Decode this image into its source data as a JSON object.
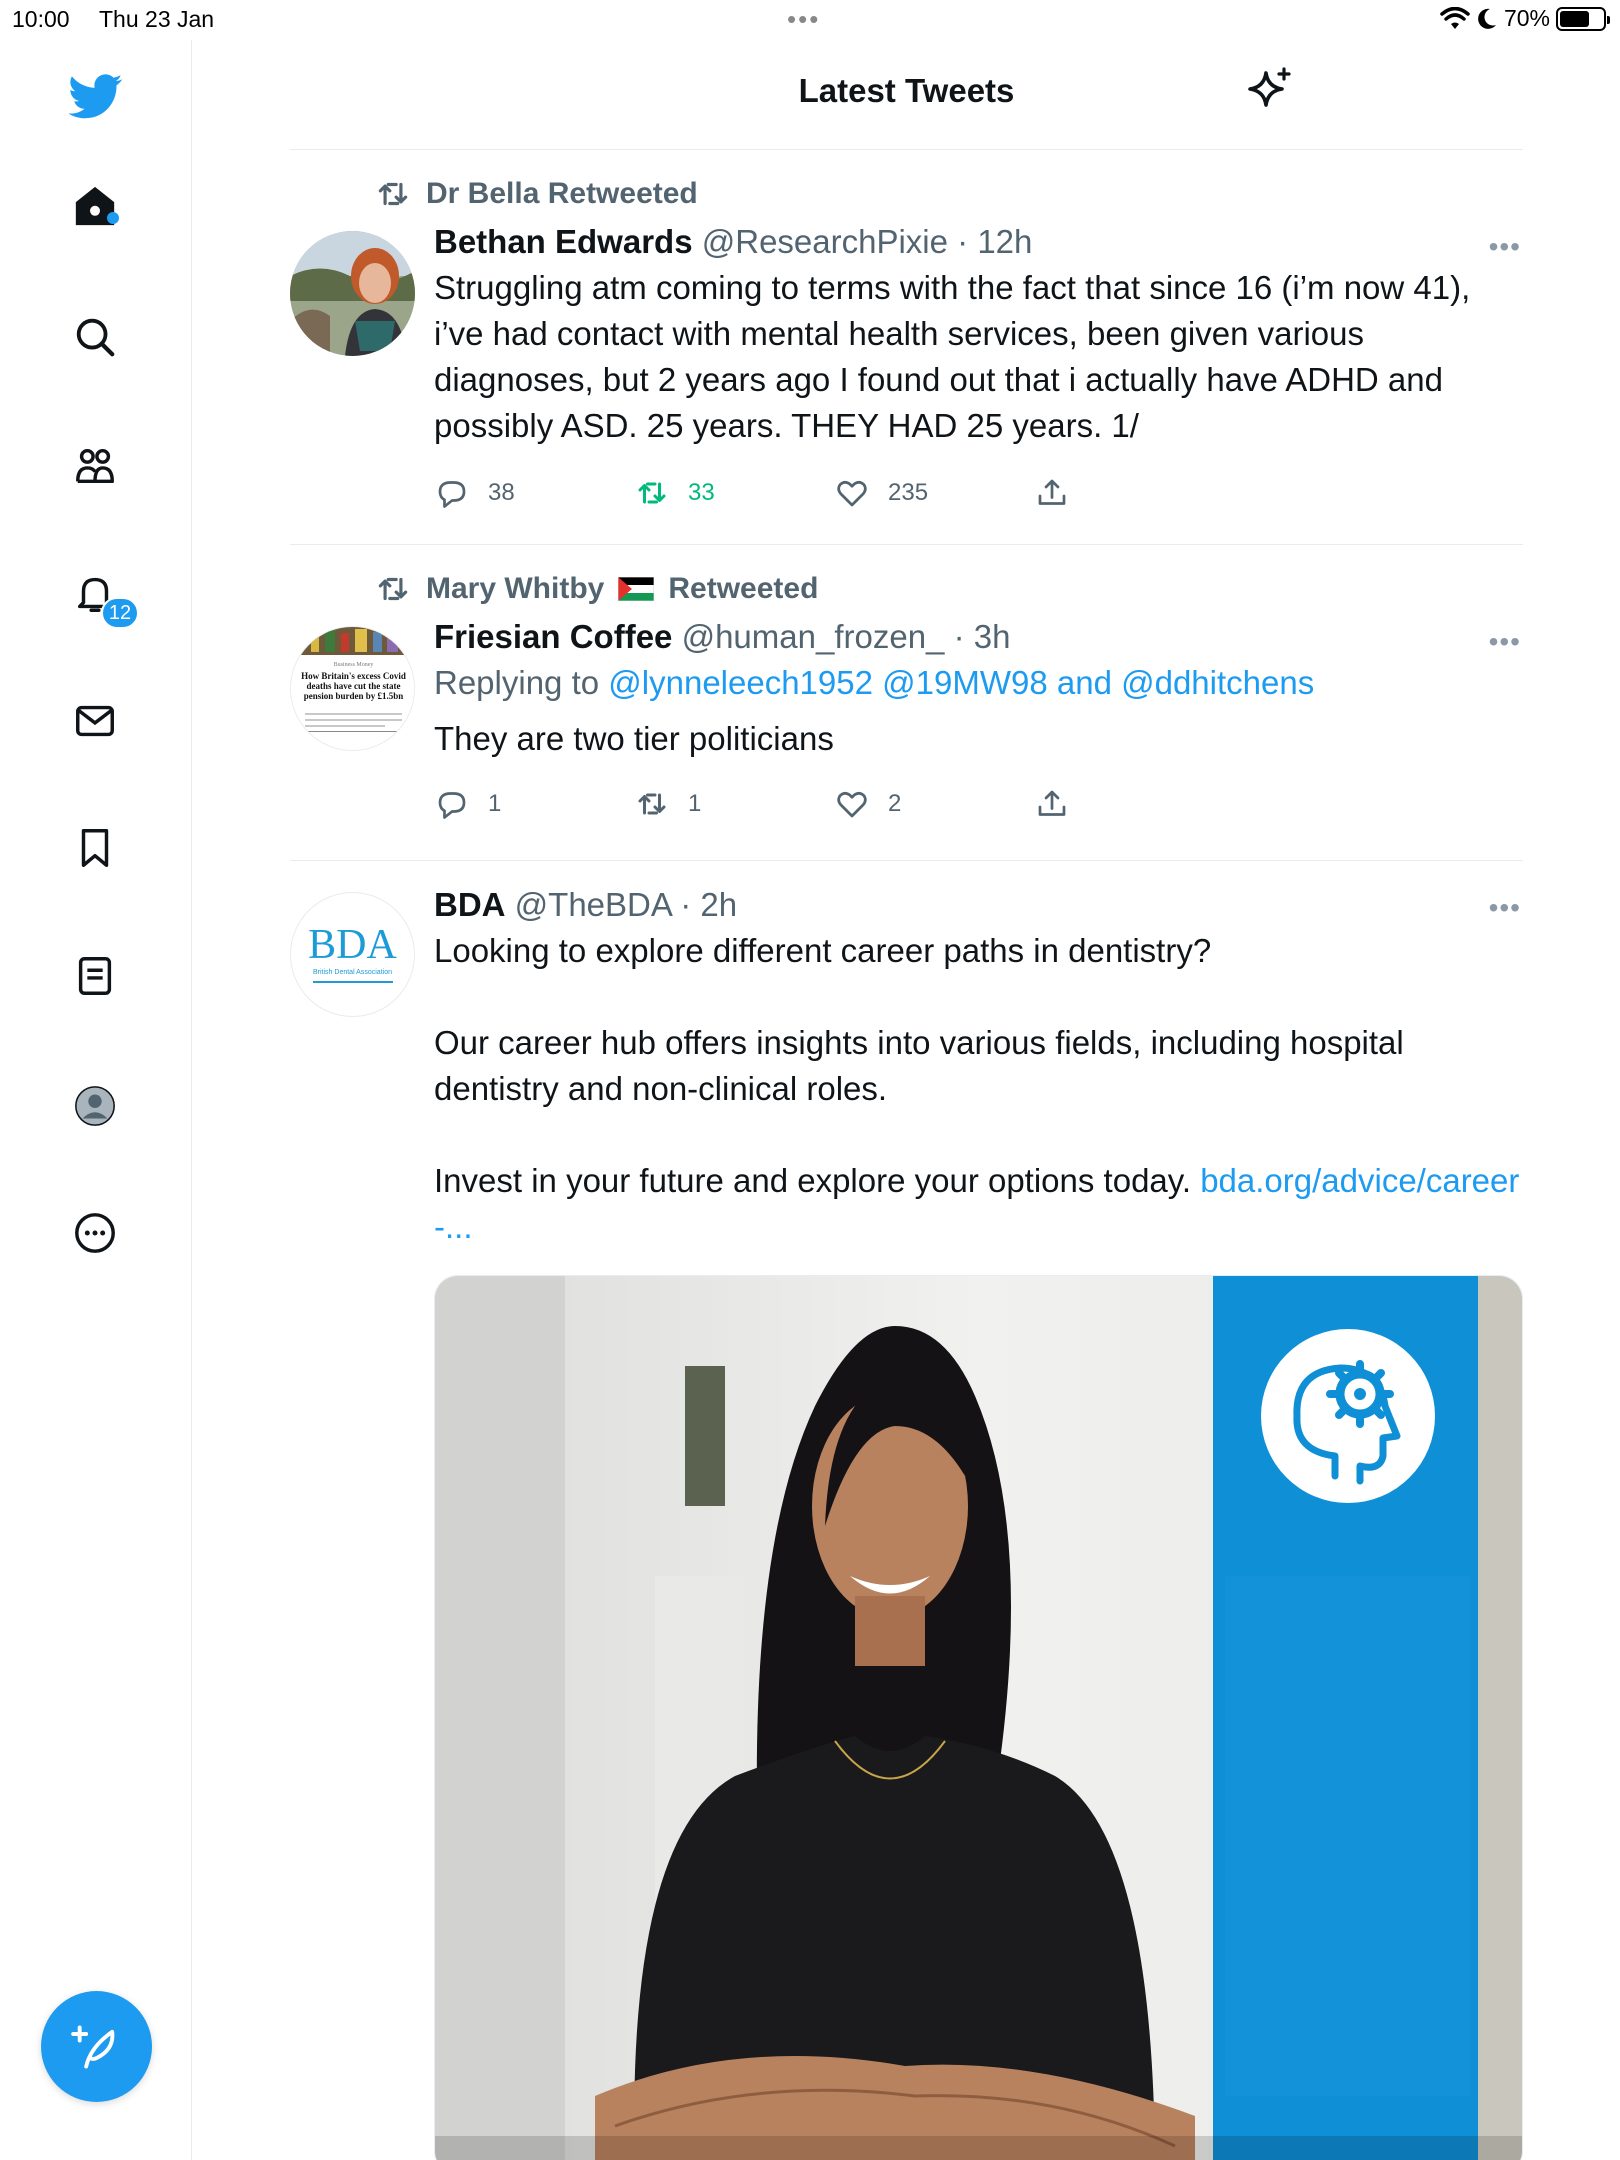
{
  "status_bar": {
    "time": "10:00",
    "date": "Thu 23 Jan",
    "battery": "70%",
    "battery_level": 0.7
  },
  "header": {
    "title": "Latest Tweets"
  },
  "sidebar": {
    "notifications_badge": "12",
    "items": [
      "home",
      "search",
      "communities",
      "notifications",
      "messages",
      "bookmarks",
      "lists",
      "profile",
      "more"
    ]
  },
  "tweets": [
    {
      "retweeted_by": "Dr Bella Retweeted",
      "name": "Bethan Edwards",
      "handle": "@ResearchPixie",
      "time": "· 12h",
      "text": "Struggling atm coming to terms with the fact that since 16 (i’m now 41), i’ve had contact with mental health services, been given various diagnoses, but 2 years ago I found out that i actually have ADHD and possibly ASD.  25 years.  THEY HAD 25 years.  1/",
      "replies": "38",
      "retweets": "33",
      "likes": "235"
    },
    {
      "retweeted_by_name": "Mary Whitby",
      "retweeted_by_suffix": "Retweeted",
      "name": "Friesian Coffee",
      "handle": "@human_frozen_",
      "time": "· 3h",
      "replying_prefix": "Replying to",
      "replying_to": "@lynneleech1952 @19MW98 and @ddhitchens",
      "text": "They are two tier politicians",
      "replies": "1",
      "retweets": "1",
      "likes": "2",
      "avatar_text": {
        "kicker": "Business Money",
        "headline": "How Britain's excess Covid deaths have cut the state pension burden by £1.5bn"
      }
    },
    {
      "name": "BDA",
      "handle": "@TheBDA",
      "time": "· 2h",
      "para1": "Looking to explore different career paths in dentistry?",
      "para2": "Our career hub offers insights into various fields, including hospital dentistry and non-clinical roles.",
      "para3": "Invest in your future and explore your options today.",
      "link": "bda.org/advice/career-...",
      "avatar_logo": "BDA",
      "avatar_sub": "British Dental Association"
    }
  ],
  "colors": {
    "accent": "#1d9bf0",
    "retweet_active": "#00ba7c",
    "muted": "#536471",
    "media_blue": "#0f8fd6"
  }
}
